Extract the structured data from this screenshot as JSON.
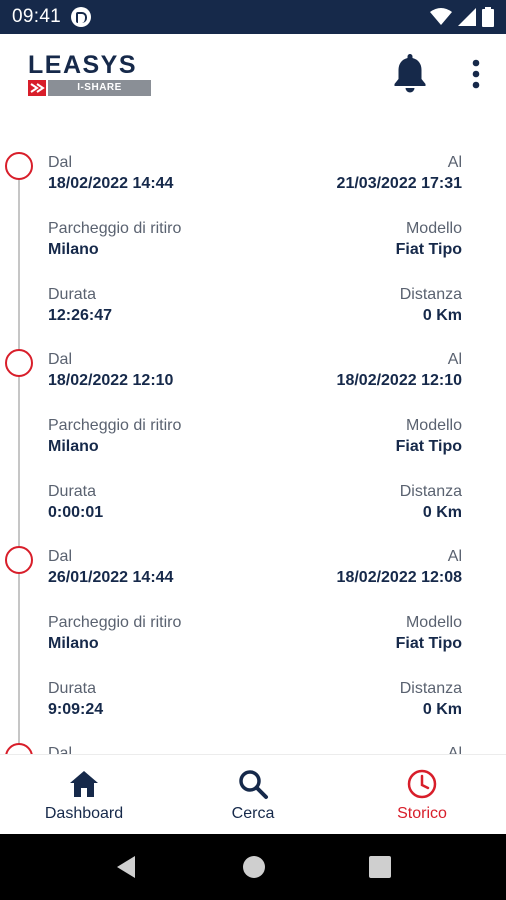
{
  "status_bar": {
    "time": "09:41"
  },
  "header": {
    "logo_text": "LEASYS",
    "logo_sub": "I-SHARE"
  },
  "records": [
    {
      "from_label": "Dal",
      "from_value": "18/02/2022 14:44",
      "to_label": "Al",
      "to_value": "21/03/2022 17:31",
      "parking_label": "Parcheggio di ritiro",
      "parking_value": "Milano",
      "model_label": "Modello",
      "model_value": "Fiat Tipo",
      "duration_label": "Durata",
      "duration_value": "12:26:47",
      "distance_label": "Distanza",
      "distance_value": "0 Km"
    },
    {
      "from_label": "Dal",
      "from_value": "18/02/2022 12:10",
      "to_label": "Al",
      "to_value": "18/02/2022 12:10",
      "parking_label": "Parcheggio di ritiro",
      "parking_value": "Milano",
      "model_label": "Modello",
      "model_value": "Fiat Tipo",
      "duration_label": "Durata",
      "duration_value": "0:00:01",
      "distance_label": "Distanza",
      "distance_value": "0 Km"
    },
    {
      "from_label": "Dal",
      "from_value": "26/01/2022 14:44",
      "to_label": "Al",
      "to_value": "18/02/2022 12:08",
      "parking_label": "Parcheggio di ritiro",
      "parking_value": "Milano",
      "model_label": "Modello",
      "model_value": "Fiat Tipo",
      "duration_label": "Durata",
      "duration_value": "9:09:24",
      "distance_label": "Distanza",
      "distance_value": "0 Km"
    },
    {
      "from_label": "Dal",
      "from_value": "",
      "to_label": "Al",
      "to_value": "",
      "parking_label": "",
      "parking_value": "",
      "model_label": "",
      "model_value": "",
      "duration_label": "",
      "duration_value": "",
      "distance_label": "",
      "distance_value": ""
    }
  ],
  "bottom_nav": {
    "items": [
      {
        "label": "Dashboard",
        "icon": "home-icon"
      },
      {
        "label": "Cerca",
        "icon": "search-icon"
      },
      {
        "label": "Storico",
        "icon": "clock-icon",
        "active": true
      }
    ]
  },
  "colors": {
    "brand_navy": "#16294a",
    "accent_red": "#d81e2a",
    "label_gray": "#5a6270"
  }
}
